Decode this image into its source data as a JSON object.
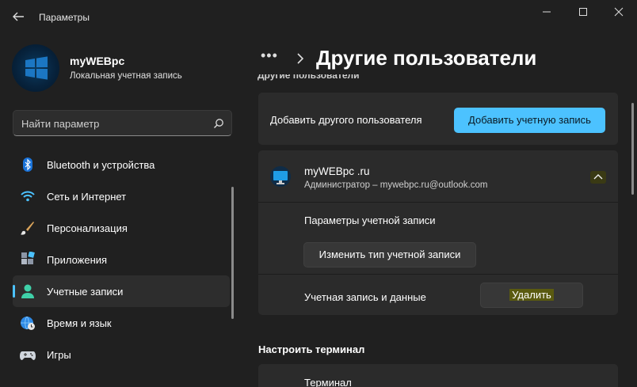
{
  "window": {
    "title": "Параметры",
    "controls": {
      "minimize": "minimize-icon",
      "maximize": "maximize-icon",
      "close": "close-icon"
    }
  },
  "profile": {
    "name": "myWEBpc",
    "account_type": "Локальная учетная запись"
  },
  "search": {
    "placeholder": "Найти параметр"
  },
  "sidebar": {
    "items": [
      {
        "label": "Bluetooth и устройства",
        "icon": "bluetooth-icon",
        "active": false
      },
      {
        "label": "Сеть и Интернет",
        "icon": "wifi-icon",
        "active": false
      },
      {
        "label": "Персонализация",
        "icon": "brush-icon",
        "active": false
      },
      {
        "label": "Приложения",
        "icon": "apps-icon",
        "active": false
      },
      {
        "label": "Учетные записи",
        "icon": "person-icon",
        "active": true
      },
      {
        "label": "Время и язык",
        "icon": "globe-clock-icon",
        "active": false
      },
      {
        "label": "Игры",
        "icon": "gamepad-icon",
        "active": false
      }
    ]
  },
  "breadcrumb": {
    "more": "•••",
    "title": "Другие пользователи"
  },
  "main": {
    "clipped_heading": "Другие пользователи",
    "add_user": {
      "label": "Добавить другого пользователя",
      "button": "Добавить учетную запись"
    },
    "user": {
      "name": "myWEBpc .ru",
      "details": "Администратор – mywebpc.ru@outlook.com",
      "account_settings_label": "Параметры учетной записи",
      "change_type_button": "Изменить тип учетной записи",
      "account_data_label": "Учетная запись и данные",
      "delete_button": "Удалить"
    },
    "kiosk": {
      "heading": "Настроить терминал",
      "item_label": "Терминал"
    }
  },
  "colors": {
    "background": "#202020",
    "card": "#2b2b2b",
    "accent": "#4cc2ff",
    "highlight": "#5a5a10"
  }
}
